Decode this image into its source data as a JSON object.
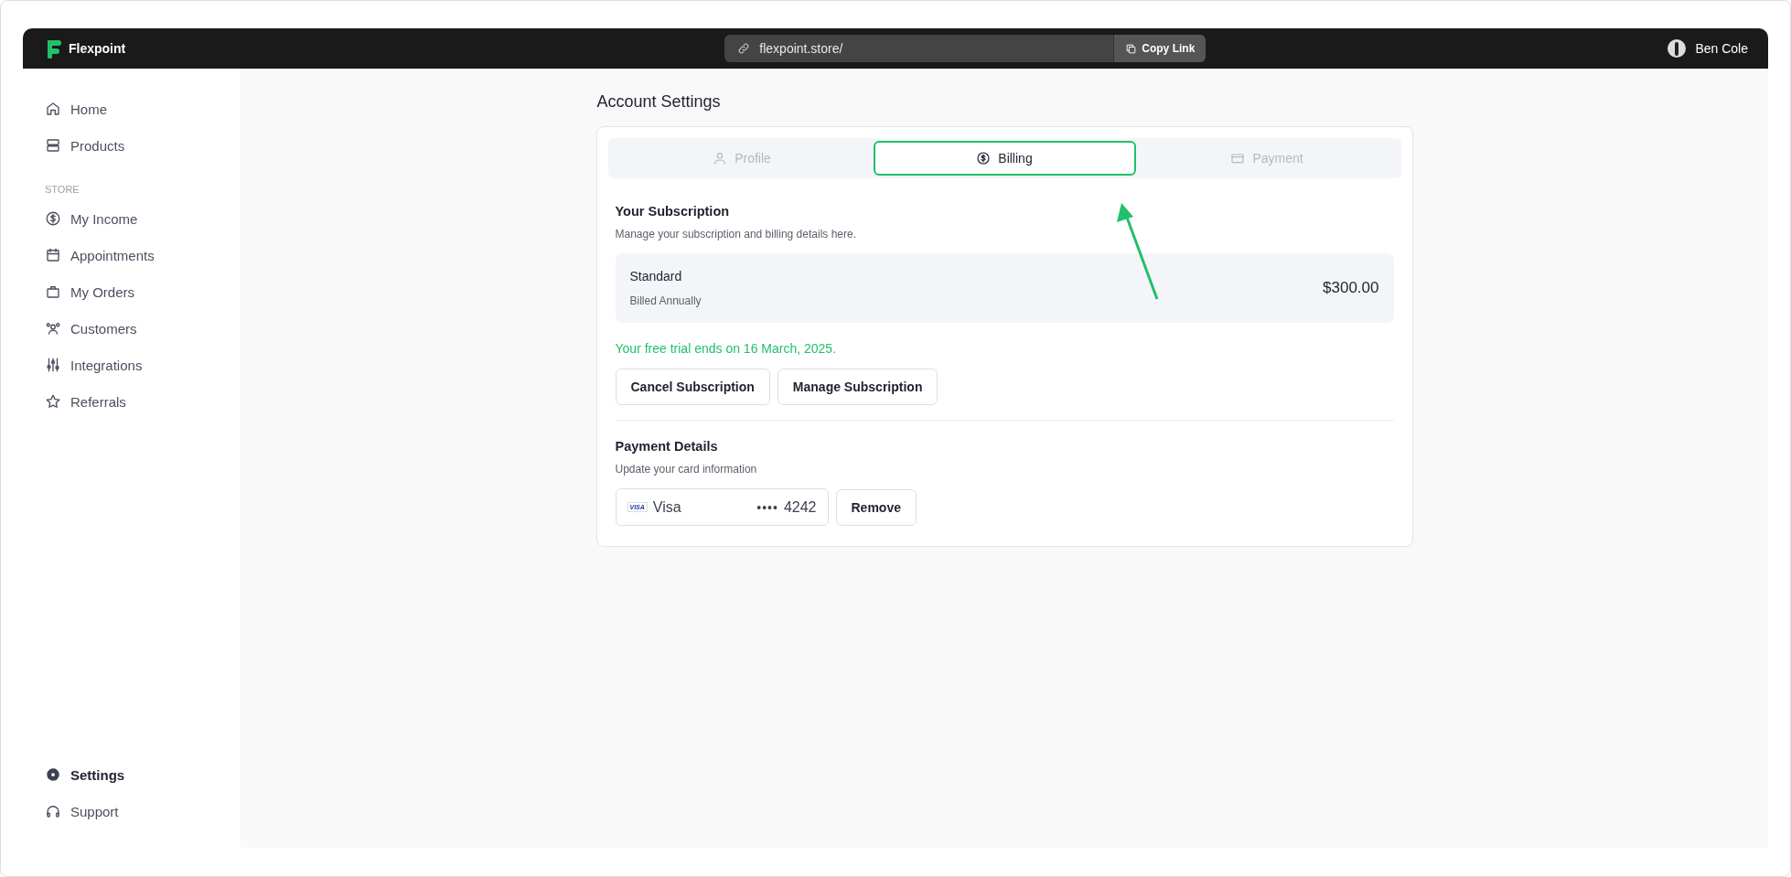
{
  "topbar": {
    "brand": "Flexpoint",
    "url": "flexpoint.store/",
    "copy_button": "Copy Link",
    "user": "Ben Cole"
  },
  "sidebar": {
    "items": [
      {
        "label": "Home",
        "selected": false
      },
      {
        "label": "Products",
        "selected": false
      }
    ],
    "section_label": "STORE",
    "store_items": [
      {
        "label": "My Income",
        "selected": false
      },
      {
        "label": "Appointments",
        "selected": false
      },
      {
        "label": "My Orders",
        "selected": false
      },
      {
        "label": "Customers",
        "selected": false
      },
      {
        "label": "Integrations",
        "selected": false
      },
      {
        "label": "Referrals",
        "selected": false
      }
    ],
    "bottom_items": [
      {
        "label": "Settings",
        "selected": true
      },
      {
        "label": "Support",
        "selected": false
      }
    ]
  },
  "page_title": "Account Settings",
  "tabs": [
    {
      "label": "Profile",
      "selected": false
    },
    {
      "label": "Billing",
      "selected": true
    },
    {
      "label": "Payment",
      "selected": false
    }
  ],
  "subscription": {
    "title": "Your Subscription",
    "description": "Manage your subscription and billing details here.",
    "plan": "Standard",
    "cycle": "Billed Annually",
    "price": "$300.00",
    "trial_note": "Your free trial ends on 16 March, 2025.",
    "buttons": [
      "Cancel Subscription",
      "Manage Subscription"
    ]
  },
  "payment": {
    "title": "Payment Details",
    "description": "Update your card information",
    "card_brand": "Visa",
    "card_logo": "VISA",
    "card_dots": "••••",
    "card_last4": "4242",
    "remove_button": "Remove"
  }
}
